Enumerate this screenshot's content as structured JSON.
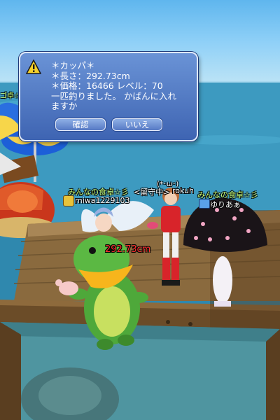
{
  "dialog": {
    "lines": [
      "＊カッパ＊",
      "＊長さ：292.73cm",
      "＊価格：16466 レベル：70",
      "一匹釣りました。 かばんに入れ",
      "ますか"
    ],
    "confirm_label": "確認",
    "cancel_label": "いいえ",
    "icon": "warning-icon"
  },
  "labels": {
    "left_edge": "ゴ卓☆",
    "face": "(*･ω･)",
    "guild_1": "みんなの食卓☆彡",
    "status": "<留守中>",
    "player_1": "rokuh",
    "guild_2": "みんなの食卓☆彡",
    "player_2": "miwa1229103",
    "player_3": "ゆりあぁ",
    "catch_length": "292.73cm"
  },
  "colors": {
    "dialog_bg": "#4a73c2",
    "name_text": "#ffffff",
    "guild_text": "#c9ff7a",
    "catch_text": "#ff3030"
  }
}
